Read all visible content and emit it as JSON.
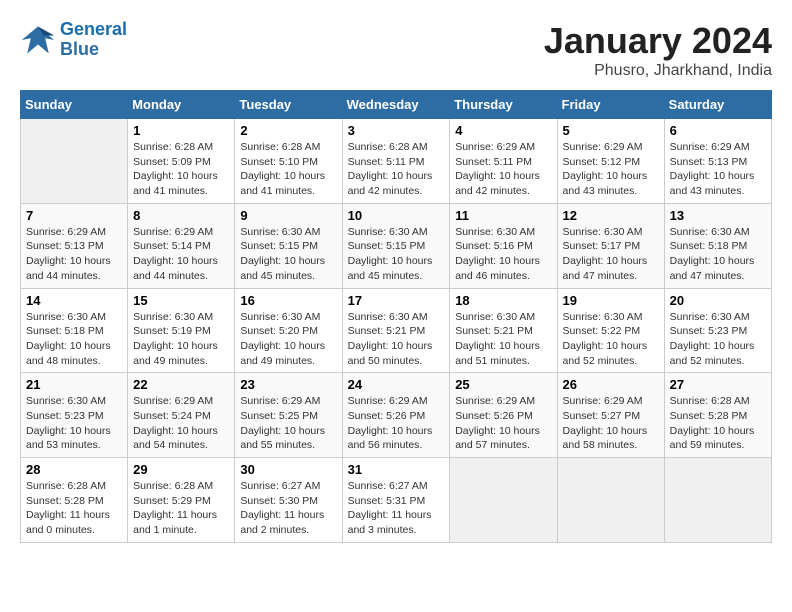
{
  "header": {
    "logo_line1": "General",
    "logo_line2": "Blue",
    "month": "January 2024",
    "location": "Phusro, Jharkhand, India"
  },
  "weekdays": [
    "Sunday",
    "Monday",
    "Tuesday",
    "Wednesday",
    "Thursday",
    "Friday",
    "Saturday"
  ],
  "weeks": [
    [
      {
        "day": "",
        "sunrise": "",
        "sunset": "",
        "daylight": ""
      },
      {
        "day": "1",
        "sunrise": "Sunrise: 6:28 AM",
        "sunset": "Sunset: 5:09 PM",
        "daylight": "Daylight: 10 hours and 41 minutes."
      },
      {
        "day": "2",
        "sunrise": "Sunrise: 6:28 AM",
        "sunset": "Sunset: 5:10 PM",
        "daylight": "Daylight: 10 hours and 41 minutes."
      },
      {
        "day": "3",
        "sunrise": "Sunrise: 6:28 AM",
        "sunset": "Sunset: 5:11 PM",
        "daylight": "Daylight: 10 hours and 42 minutes."
      },
      {
        "day": "4",
        "sunrise": "Sunrise: 6:29 AM",
        "sunset": "Sunset: 5:11 PM",
        "daylight": "Daylight: 10 hours and 42 minutes."
      },
      {
        "day": "5",
        "sunrise": "Sunrise: 6:29 AM",
        "sunset": "Sunset: 5:12 PM",
        "daylight": "Daylight: 10 hours and 43 minutes."
      },
      {
        "day": "6",
        "sunrise": "Sunrise: 6:29 AM",
        "sunset": "Sunset: 5:13 PM",
        "daylight": "Daylight: 10 hours and 43 minutes."
      }
    ],
    [
      {
        "day": "7",
        "sunrise": "Sunrise: 6:29 AM",
        "sunset": "Sunset: 5:13 PM",
        "daylight": "Daylight: 10 hours and 44 minutes."
      },
      {
        "day": "8",
        "sunrise": "Sunrise: 6:29 AM",
        "sunset": "Sunset: 5:14 PM",
        "daylight": "Daylight: 10 hours and 44 minutes."
      },
      {
        "day": "9",
        "sunrise": "Sunrise: 6:30 AM",
        "sunset": "Sunset: 5:15 PM",
        "daylight": "Daylight: 10 hours and 45 minutes."
      },
      {
        "day": "10",
        "sunrise": "Sunrise: 6:30 AM",
        "sunset": "Sunset: 5:15 PM",
        "daylight": "Daylight: 10 hours and 45 minutes."
      },
      {
        "day": "11",
        "sunrise": "Sunrise: 6:30 AM",
        "sunset": "Sunset: 5:16 PM",
        "daylight": "Daylight: 10 hours and 46 minutes."
      },
      {
        "day": "12",
        "sunrise": "Sunrise: 6:30 AM",
        "sunset": "Sunset: 5:17 PM",
        "daylight": "Daylight: 10 hours and 47 minutes."
      },
      {
        "day": "13",
        "sunrise": "Sunrise: 6:30 AM",
        "sunset": "Sunset: 5:18 PM",
        "daylight": "Daylight: 10 hours and 47 minutes."
      }
    ],
    [
      {
        "day": "14",
        "sunrise": "Sunrise: 6:30 AM",
        "sunset": "Sunset: 5:18 PM",
        "daylight": "Daylight: 10 hours and 48 minutes."
      },
      {
        "day": "15",
        "sunrise": "Sunrise: 6:30 AM",
        "sunset": "Sunset: 5:19 PM",
        "daylight": "Daylight: 10 hours and 49 minutes."
      },
      {
        "day": "16",
        "sunrise": "Sunrise: 6:30 AM",
        "sunset": "Sunset: 5:20 PM",
        "daylight": "Daylight: 10 hours and 49 minutes."
      },
      {
        "day": "17",
        "sunrise": "Sunrise: 6:30 AM",
        "sunset": "Sunset: 5:21 PM",
        "daylight": "Daylight: 10 hours and 50 minutes."
      },
      {
        "day": "18",
        "sunrise": "Sunrise: 6:30 AM",
        "sunset": "Sunset: 5:21 PM",
        "daylight": "Daylight: 10 hours and 51 minutes."
      },
      {
        "day": "19",
        "sunrise": "Sunrise: 6:30 AM",
        "sunset": "Sunset: 5:22 PM",
        "daylight": "Daylight: 10 hours and 52 minutes."
      },
      {
        "day": "20",
        "sunrise": "Sunrise: 6:30 AM",
        "sunset": "Sunset: 5:23 PM",
        "daylight": "Daylight: 10 hours and 52 minutes."
      }
    ],
    [
      {
        "day": "21",
        "sunrise": "Sunrise: 6:30 AM",
        "sunset": "Sunset: 5:23 PM",
        "daylight": "Daylight: 10 hours and 53 minutes."
      },
      {
        "day": "22",
        "sunrise": "Sunrise: 6:29 AM",
        "sunset": "Sunset: 5:24 PM",
        "daylight": "Daylight: 10 hours and 54 minutes."
      },
      {
        "day": "23",
        "sunrise": "Sunrise: 6:29 AM",
        "sunset": "Sunset: 5:25 PM",
        "daylight": "Daylight: 10 hours and 55 minutes."
      },
      {
        "day": "24",
        "sunrise": "Sunrise: 6:29 AM",
        "sunset": "Sunset: 5:26 PM",
        "daylight": "Daylight: 10 hours and 56 minutes."
      },
      {
        "day": "25",
        "sunrise": "Sunrise: 6:29 AM",
        "sunset": "Sunset: 5:26 PM",
        "daylight": "Daylight: 10 hours and 57 minutes."
      },
      {
        "day": "26",
        "sunrise": "Sunrise: 6:29 AM",
        "sunset": "Sunset: 5:27 PM",
        "daylight": "Daylight: 10 hours and 58 minutes."
      },
      {
        "day": "27",
        "sunrise": "Sunrise: 6:28 AM",
        "sunset": "Sunset: 5:28 PM",
        "daylight": "Daylight: 10 hours and 59 minutes."
      }
    ],
    [
      {
        "day": "28",
        "sunrise": "Sunrise: 6:28 AM",
        "sunset": "Sunset: 5:28 PM",
        "daylight": "Daylight: 11 hours and 0 minutes."
      },
      {
        "day": "29",
        "sunrise": "Sunrise: 6:28 AM",
        "sunset": "Sunset: 5:29 PM",
        "daylight": "Daylight: 11 hours and 1 minute."
      },
      {
        "day": "30",
        "sunrise": "Sunrise: 6:27 AM",
        "sunset": "Sunset: 5:30 PM",
        "daylight": "Daylight: 11 hours and 2 minutes."
      },
      {
        "day": "31",
        "sunrise": "Sunrise: 6:27 AM",
        "sunset": "Sunset: 5:31 PM",
        "daylight": "Daylight: 11 hours and 3 minutes."
      },
      {
        "day": "",
        "sunrise": "",
        "sunset": "",
        "daylight": ""
      },
      {
        "day": "",
        "sunrise": "",
        "sunset": "",
        "daylight": ""
      },
      {
        "day": "",
        "sunrise": "",
        "sunset": "",
        "daylight": ""
      }
    ]
  ]
}
